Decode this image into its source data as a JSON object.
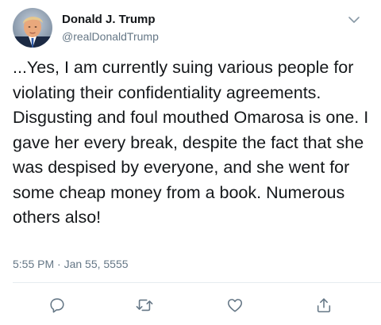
{
  "tweet": {
    "display_name": "Donald J. Trump",
    "handle": "@realDonaldTrump",
    "text": "...Yes, I am currently suing various people for violating their confidentiality agreements. Disgusting and foul mouthed Omarosa is one. I gave her every break, despite the fact that she was despised by everyone, and she went for some cheap money from a book. Numerous others also!",
    "timestamp": "5:55 PM · Jan 55, 5555"
  },
  "icons": {
    "menu": "chevron-down-icon",
    "reply": "reply-icon",
    "retweet": "retweet-icon",
    "like": "heart-icon",
    "share": "share-icon"
  },
  "colors": {
    "text": "#14171a",
    "secondary": "#657786",
    "divider": "#e6ecf0"
  }
}
